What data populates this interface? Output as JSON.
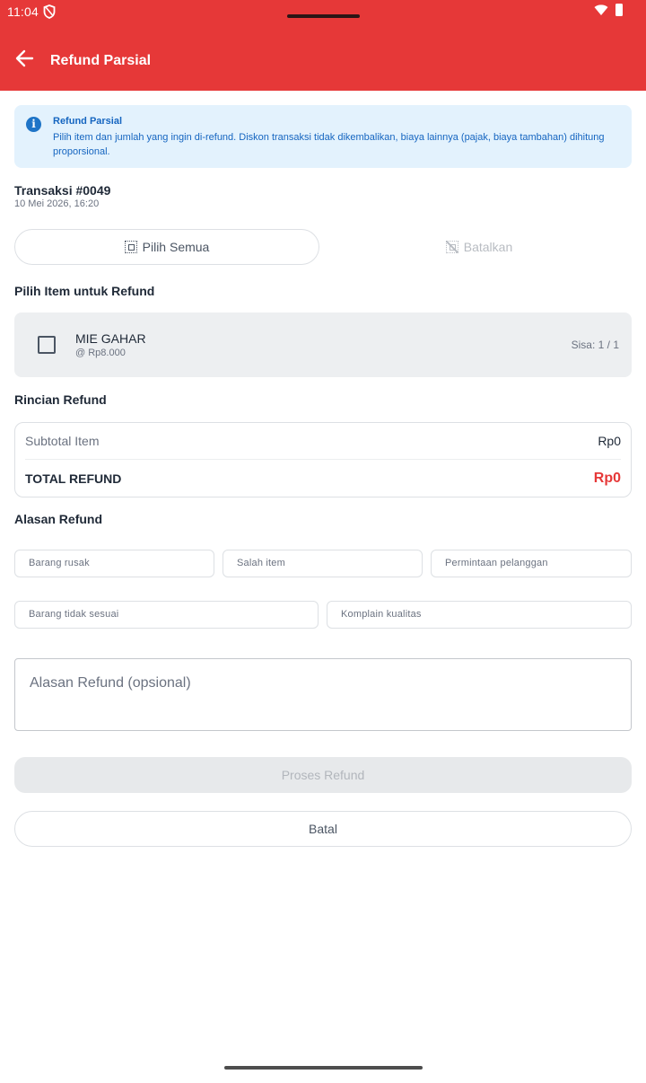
{
  "status_bar": {
    "time": "11:04"
  },
  "app_bar": {
    "title": "Refund Parsial"
  },
  "info_banner": {
    "title": "Refund Parsial",
    "text": "Pilih item dan jumlah yang ingin di-refund. Diskon transaksi tidak dikembalikan, biaya lainnya (pajak, biaya tambahan) dihitung proporsional."
  },
  "transaction": {
    "title": "Transaksi #0049",
    "date": "10 Mei 2026, 16:20"
  },
  "selection": {
    "select_all_label": "Pilih Semua",
    "cancel_label": "Batalkan"
  },
  "items_section": {
    "heading": "Pilih Item untuk Refund",
    "items": [
      {
        "name": "MIE GAHAR",
        "price": "@ Rp8.000",
        "remaining": "Sisa: 1 / 1",
        "checked": false
      }
    ]
  },
  "summary": {
    "heading": "Rincian Refund",
    "subtotal_label": "Subtotal Item",
    "subtotal_value": "Rp0",
    "total_label": "TOTAL REFUND",
    "total_value": "Rp0"
  },
  "reason": {
    "heading": "Alasan Refund",
    "chips": [
      "Barang rusak",
      "Salah item",
      "Permintaan pelanggan",
      "Barang tidak sesuai",
      "Komplain kualitas"
    ],
    "input_placeholder": "Alasan Refund (opsional)",
    "input_value": ""
  },
  "actions": {
    "process_label": "Proses Refund",
    "cancel_label": "Batal"
  },
  "colors": {
    "primary": "#e63838",
    "info_bg": "#e3f2fd",
    "info_text": "#1565c0"
  }
}
